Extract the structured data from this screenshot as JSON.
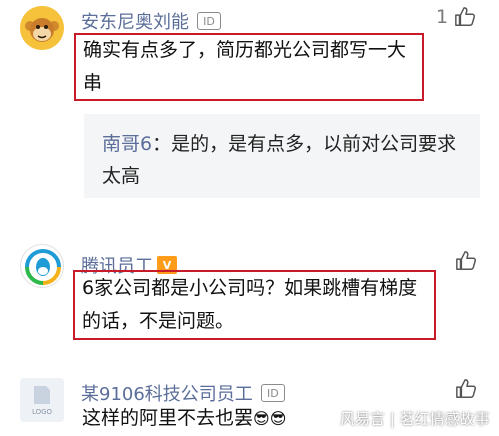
{
  "comments": [
    {
      "username": "安东尼奥刘能",
      "id_badge": "ID",
      "like_count": "1",
      "body": "确实有点多了，简历都光公司都写一大串",
      "reply": {
        "author": "南哥6",
        "separator": "：",
        "text": "是的，是有点多，以前对公司要求太高"
      }
    },
    {
      "username": "腾讯员工",
      "v_badge": "V",
      "body": "6家公司都是小公司吗？如果跳槽有梯度的话，不是问题。"
    },
    {
      "username": "某9106科技公司员工",
      "id_badge": "ID",
      "avatar_text": "LOGO",
      "body": "这样的阿里不去也罢",
      "emoji": "😎😎"
    }
  ],
  "watermark": "风易言 | 茗红情感故事",
  "colors": {
    "username": "#5b6e9a",
    "highlight_box": "#c91a2a",
    "reply_bg": "#f4f5f7",
    "v_badge": "#ff9c1a"
  }
}
